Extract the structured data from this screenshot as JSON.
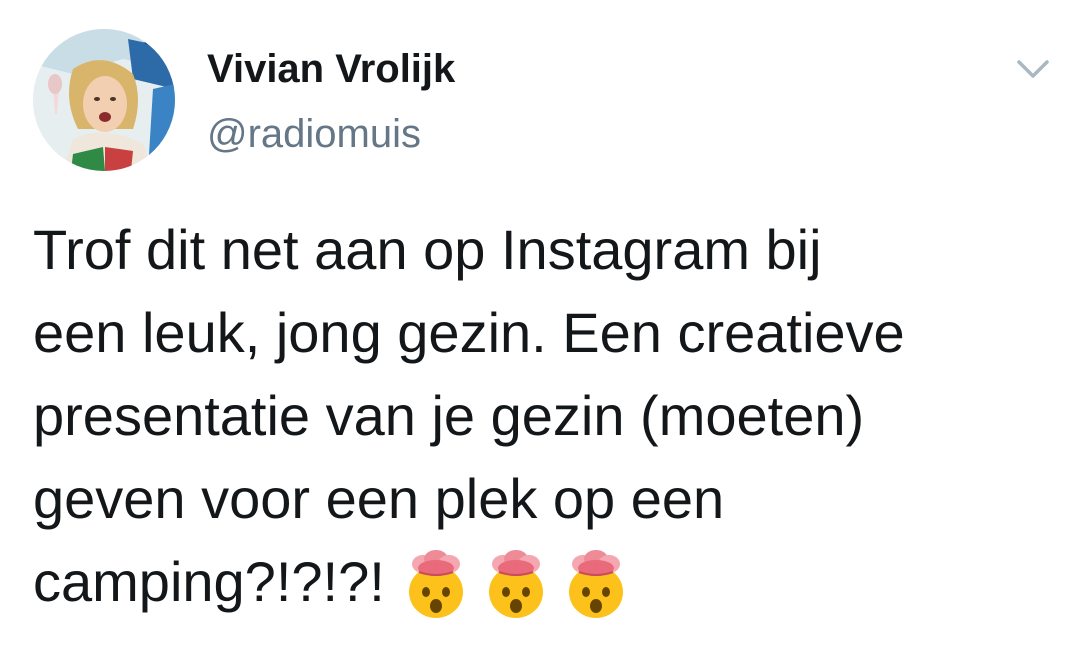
{
  "tweet": {
    "author": {
      "display_name": "Vivian Vrolijk",
      "handle": "@radiomuis",
      "avatar_icon": "profile-photo"
    },
    "menu_icon": "chevron-down-icon",
    "text_lines": [
      "Trof dit net aan op Instagram bij",
      "een leuk, jong gezin. Een creatieve",
      "presentatie van je gezin (moeten)",
      "geven voor een plek op een",
      "camping?!?!?!"
    ],
    "emojis": [
      "exploding-head",
      "exploding-head",
      "exploding-head"
    ]
  },
  "colors": {
    "text": "#14171a",
    "secondary": "#657786",
    "caret": "#aab8c2"
  }
}
